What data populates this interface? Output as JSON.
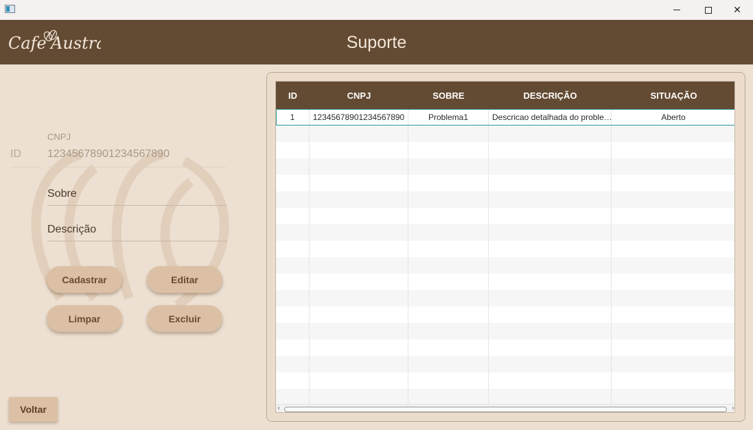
{
  "window": {
    "minimize_glyph": "",
    "maximize_glyph": "",
    "close_glyph": "✕"
  },
  "header": {
    "logo_text": "Cafe Austral",
    "title": "Suporte"
  },
  "form": {
    "cnpj_label": "CNPJ",
    "id_value": "ID",
    "cnpj_value": "12345678901234567890",
    "sobre_placeholder": "Sobre",
    "descricao_placeholder": "Descrição",
    "buttons": {
      "cadastrar": "Cadastrar",
      "editar": "Editar",
      "limpar": "Limpar",
      "excluir": "Excluir"
    },
    "voltar": "Voltar"
  },
  "table": {
    "columns": [
      "ID",
      "CNPJ",
      "SOBRE",
      "DESCRIÇÃO",
      "SITUAÇÃO"
    ],
    "rows": [
      [
        "1",
        "12345678901234567890",
        "Problema1",
        "Descricao detalhada do proble…",
        "Aberto"
      ]
    ],
    "empty_row_count": 17
  },
  "colors": {
    "header_brown": "#634a32",
    "background": "#ede0d2",
    "button": "#dcc0a5",
    "selection": "#2a9a9a"
  }
}
